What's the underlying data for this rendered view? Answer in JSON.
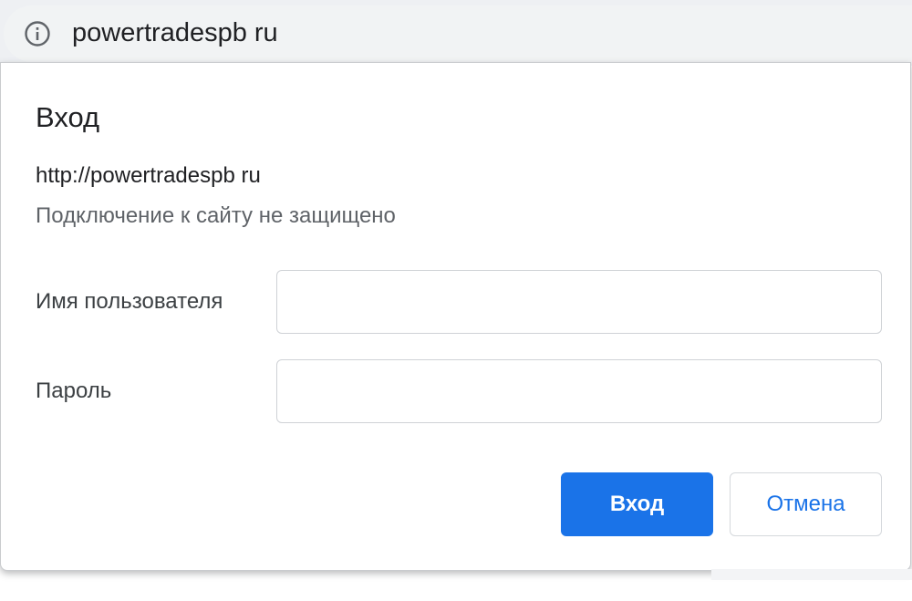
{
  "omnibox": {
    "url": "powertradespb ru",
    "icon": "info-icon"
  },
  "dialog": {
    "title": "Вход",
    "origin": "http://powertradespb ru",
    "warning": "Подключение к сайту не защищено",
    "username_label": "Имя пользователя",
    "username_value": "",
    "password_label": "Пароль",
    "password_value": "",
    "login_button": "Вход",
    "cancel_button": "Отмена"
  },
  "colors": {
    "accent": "#1a73e8",
    "text_primary": "#202124",
    "text_secondary": "#5f6368",
    "omnibox_bg": "#f1f3f4"
  }
}
